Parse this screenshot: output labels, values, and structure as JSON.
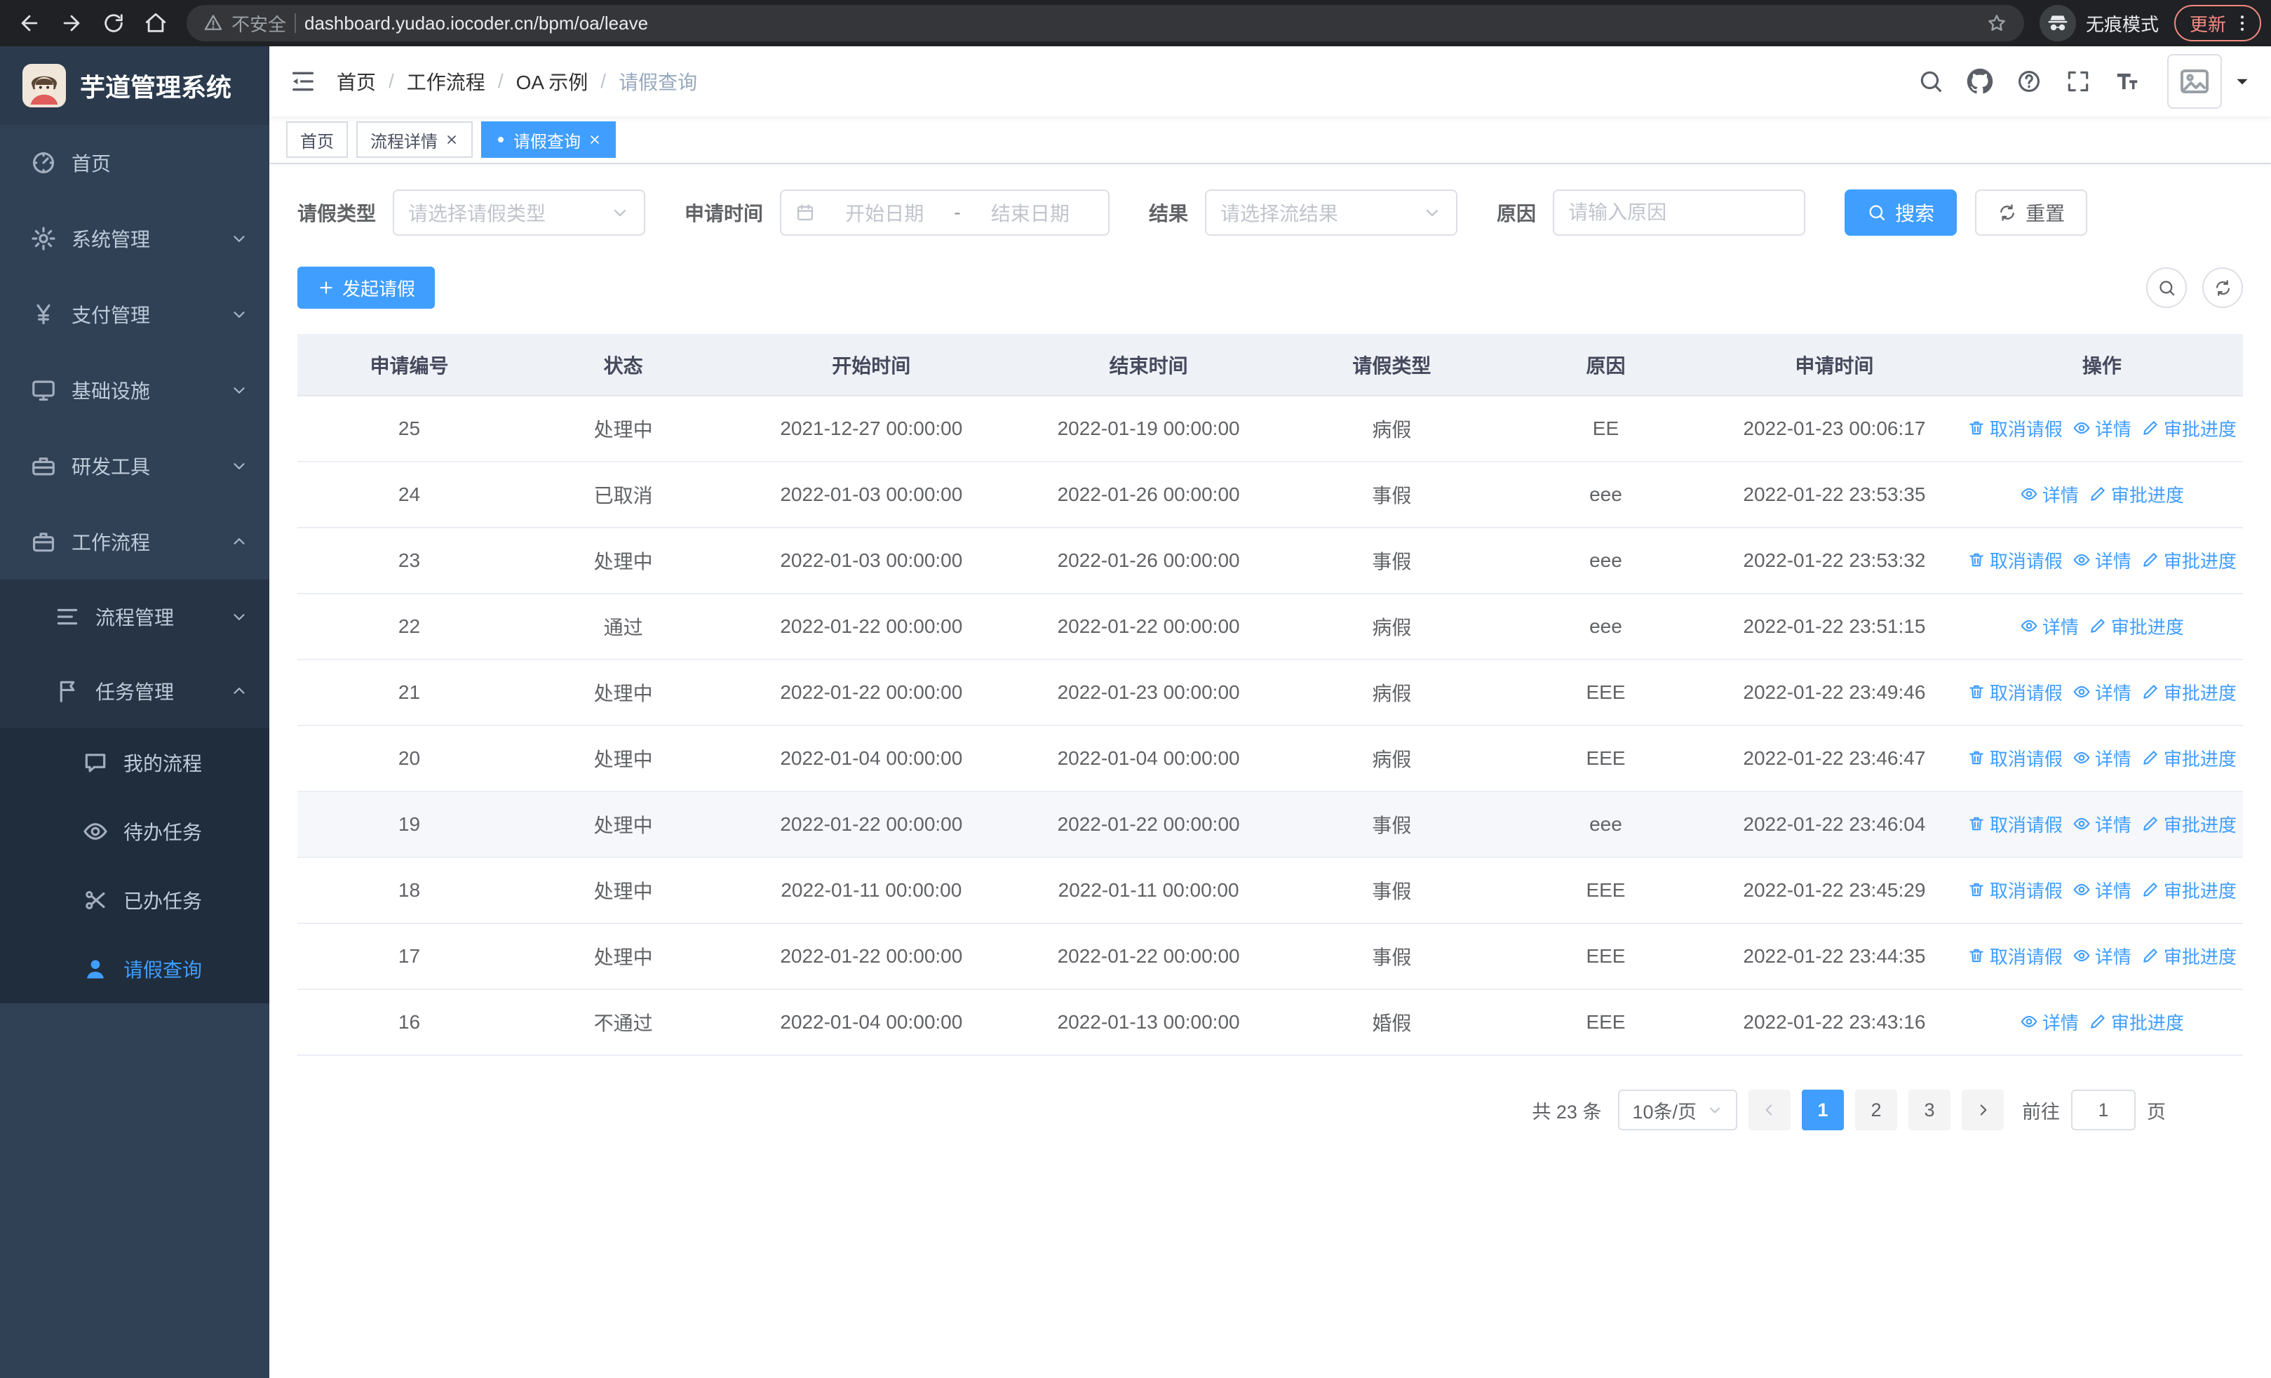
{
  "browser": {
    "security_label": "不安全",
    "url": "dashboard.yudao.iocoder.cn/bpm/oa/leave",
    "incognito_label": "无痕模式",
    "update_label": "更新"
  },
  "sidebar": {
    "logo_title": "芋道管理系统",
    "menu": [
      {
        "key": "home",
        "label": "首页",
        "icon": "dashboard-icon"
      },
      {
        "key": "system-management",
        "label": "系统管理",
        "icon": "gear-icon",
        "arrow": "down"
      },
      {
        "key": "payment-management",
        "label": "支付管理",
        "icon": "yen-icon",
        "arrow": "down"
      },
      {
        "key": "infrastructure",
        "label": "基础设施",
        "icon": "monitor-icon",
        "arrow": "down"
      },
      {
        "key": "dev-tools",
        "label": "研发工具",
        "icon": "toolbox-icon",
        "arrow": "down"
      },
      {
        "key": "workflow",
        "label": "工作流程",
        "icon": "briefcase-icon",
        "arrow": "up",
        "open": true,
        "children": [
          {
            "key": "process-management",
            "label": "流程管理",
            "icon": "tree-icon",
            "arrow": "down"
          },
          {
            "key": "task-management",
            "label": "任务管理",
            "icon": "flag-icon",
            "arrow": "up",
            "open": true,
            "children": [
              {
                "key": "my-process",
                "label": "我的流程",
                "icon": "chat-icon"
              },
              {
                "key": "todo-tasks",
                "label": "待办任务",
                "icon": "eye-icon"
              },
              {
                "key": "done-tasks",
                "label": "已办任务",
                "icon": "scissors-icon"
              },
              {
                "key": "leave-query",
                "label": "请假查询",
                "icon": "user-icon",
                "active": true
              }
            ]
          }
        ]
      }
    ]
  },
  "header": {
    "breadcrumb": [
      "首页",
      "工作流程",
      "OA 示例",
      "请假查询"
    ]
  },
  "tabs": [
    {
      "key": "home",
      "label": "首页",
      "closable": false,
      "active": false
    },
    {
      "key": "process-detail",
      "label": "流程详情",
      "closable": true,
      "active": false
    },
    {
      "key": "leave-query",
      "label": "请假查询",
      "closable": true,
      "active": true
    }
  ],
  "filters": {
    "leave_type": {
      "label": "请假类型",
      "placeholder": "请选择请假类型"
    },
    "apply_time": {
      "label": "申请时间",
      "start_placeholder": "开始日期",
      "separator": "-",
      "end_placeholder": "结束日期"
    },
    "result": {
      "label": "结果",
      "placeholder": "请选择流结果"
    },
    "reason": {
      "label": "原因",
      "placeholder": "请输入原因"
    },
    "search_button": "搜索",
    "reset_button": "重置"
  },
  "toolbar": {
    "create_button": "发起请假"
  },
  "table": {
    "columns": [
      "申请编号",
      "状态",
      "开始时间",
      "结束时间",
      "请假类型",
      "原因",
      "申请时间",
      "操作"
    ],
    "actions": {
      "cancel": "取消请假",
      "detail": "详情",
      "progress": "审批进度"
    },
    "rows": [
      {
        "id": "25",
        "status": "处理中",
        "start": "2021-12-27 00:00:00",
        "end": "2022-01-19 00:00:00",
        "type": "病假",
        "reason": "EE",
        "applied": "2022-01-23 00:06:17",
        "can_cancel": true,
        "highlighted": false
      },
      {
        "id": "24",
        "status": "已取消",
        "start": "2022-01-03 00:00:00",
        "end": "2022-01-26 00:00:00",
        "type": "事假",
        "reason": "eee",
        "applied": "2022-01-22 23:53:35",
        "can_cancel": false,
        "highlighted": false
      },
      {
        "id": "23",
        "status": "处理中",
        "start": "2022-01-03 00:00:00",
        "end": "2022-01-26 00:00:00",
        "type": "事假",
        "reason": "eee",
        "applied": "2022-01-22 23:53:32",
        "can_cancel": true,
        "highlighted": false
      },
      {
        "id": "22",
        "status": "通过",
        "start": "2022-01-22 00:00:00",
        "end": "2022-01-22 00:00:00",
        "type": "病假",
        "reason": "eee",
        "applied": "2022-01-22 23:51:15",
        "can_cancel": false,
        "highlighted": false
      },
      {
        "id": "21",
        "status": "处理中",
        "start": "2022-01-22 00:00:00",
        "end": "2022-01-23 00:00:00",
        "type": "病假",
        "reason": "EEE",
        "applied": "2022-01-22 23:49:46",
        "can_cancel": true,
        "highlighted": false
      },
      {
        "id": "20",
        "status": "处理中",
        "start": "2022-01-04 00:00:00",
        "end": "2022-01-04 00:00:00",
        "type": "病假",
        "reason": "EEE",
        "applied": "2022-01-22 23:46:47",
        "can_cancel": true,
        "highlighted": false
      },
      {
        "id": "19",
        "status": "处理中",
        "start": "2022-01-22 00:00:00",
        "end": "2022-01-22 00:00:00",
        "type": "事假",
        "reason": "eee",
        "applied": "2022-01-22 23:46:04",
        "can_cancel": true,
        "highlighted": true
      },
      {
        "id": "18",
        "status": "处理中",
        "start": "2022-01-11 00:00:00",
        "end": "2022-01-11 00:00:00",
        "type": "事假",
        "reason": "EEE",
        "applied": "2022-01-22 23:45:29",
        "can_cancel": true,
        "highlighted": false
      },
      {
        "id": "17",
        "status": "处理中",
        "start": "2022-01-22 00:00:00",
        "end": "2022-01-22 00:00:00",
        "type": "事假",
        "reason": "EEE",
        "applied": "2022-01-22 23:44:35",
        "can_cancel": true,
        "highlighted": false
      },
      {
        "id": "16",
        "status": "不通过",
        "start": "2022-01-04 00:00:00",
        "end": "2022-01-13 00:00:00",
        "type": "婚假",
        "reason": "EEE",
        "applied": "2022-01-22 23:43:16",
        "can_cancel": false,
        "highlighted": false
      }
    ]
  },
  "pagination": {
    "total_text": "共 23 条",
    "page_size": "10条/页",
    "pages": [
      "1",
      "2",
      "3"
    ],
    "active_page": "1",
    "goto_label": "前往",
    "goto_value": "1",
    "goto_suffix": "页"
  },
  "colors": {
    "primary": "#409EFF",
    "sidebar_bg": "#304156",
    "active_text": "#409EFF"
  }
}
